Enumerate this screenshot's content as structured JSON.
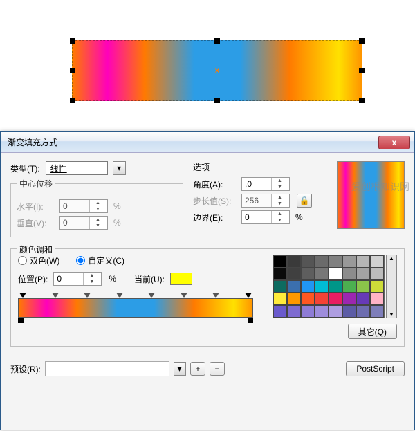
{
  "watermark": "爱创根知识网",
  "canvas": {
    "center_marker": "×"
  },
  "dialog": {
    "title": "渐变填充方式",
    "close": "x",
    "type": {
      "label": "类型(T):",
      "value": "线性"
    },
    "center_offset": {
      "legend": "中心位移",
      "horizontal": {
        "label": "水平(I):",
        "value": "0",
        "unit": "%"
      },
      "vertical": {
        "label": "垂直(V):",
        "value": "0",
        "unit": "%"
      }
    },
    "options": {
      "label": "选项",
      "angle": {
        "label": "角度(A):",
        "value": ".0"
      },
      "step": {
        "label": "步长值(S):",
        "value": "256"
      },
      "border": {
        "label": "边界(E):",
        "value": "0",
        "unit": "%"
      }
    },
    "harmony": {
      "legend": "颜色调和",
      "two_color": "双色(W)",
      "custom": "自定义(C)",
      "position": {
        "label": "位置(P):",
        "value": "0",
        "unit": "%"
      },
      "current": {
        "label": "当前(U):"
      },
      "other_btn": "其它(Q)"
    },
    "preset": {
      "label": "预设(R):",
      "add": "+",
      "remove": "−",
      "postscript_btn": "PostScript"
    },
    "palette": [
      [
        "#000000",
        "#3a3a3a",
        "#555555",
        "#6b6b6b",
        "#808080",
        "#999999",
        "#b5b5b5",
        "#d0d0d0"
      ],
      [
        "#0b0b0b",
        "#404040",
        "#5e5e5e",
        "#777777",
        "#ffffff",
        "#8c8c8c",
        "#a3a3a3",
        "#bcbcbc"
      ],
      [
        "#0d6b60",
        "#3b6fae",
        "#2196f3",
        "#00bcd4",
        "#009688",
        "#4caf50",
        "#8bc34a",
        "#cddc39"
      ],
      [
        "#ffeb3b",
        "#ff9800",
        "#ff5722",
        "#f44336",
        "#e91e63",
        "#9c27b0",
        "#673ab7",
        "#ffb3c6"
      ],
      [
        "#6a5acd",
        "#7e6bd1",
        "#8e7cd6",
        "#9e8ddc",
        "#ae9ee1",
        "#5c5ca6",
        "#6d6db0",
        "#7e7eba"
      ]
    ]
  }
}
